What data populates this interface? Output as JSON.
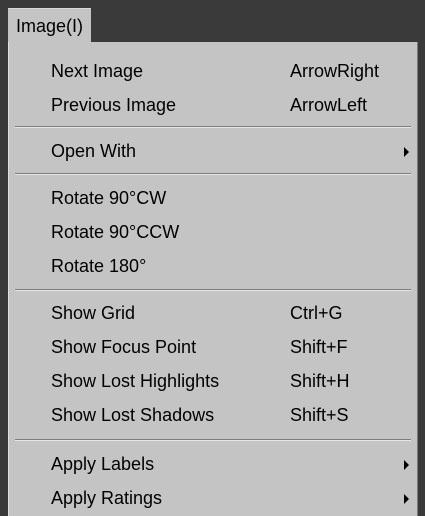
{
  "menubar": {
    "image_menu": "Image(I)"
  },
  "menu": {
    "items": [
      {
        "label": "Next Image",
        "shortcut": "ArrowRight"
      },
      {
        "label": "Previous Image",
        "shortcut": "ArrowLeft"
      },
      {
        "label": "Open With",
        "submenu_icon": "submenu-arrow-icon"
      },
      {
        "label": "Rotate 90°CW"
      },
      {
        "label": "Rotate 90°CCW"
      },
      {
        "label": "Rotate 180°"
      },
      {
        "label": "Show Grid",
        "shortcut": "Ctrl+G"
      },
      {
        "label": "Show Focus Point",
        "shortcut": "Shift+F"
      },
      {
        "label": "Show Lost Highlights",
        "shortcut": "Shift+H"
      },
      {
        "label": "Show Lost Shadows",
        "shortcut": "Shift+S"
      },
      {
        "label": "Apply Labels",
        "submenu_icon": "submenu-arrow-icon"
      },
      {
        "label": "Apply Ratings",
        "submenu_icon": "submenu-arrow-icon"
      }
    ]
  },
  "colors": {
    "menu_background": "#c4c4c4",
    "menubar_background": "#3a3a3a",
    "text": "#000000"
  }
}
